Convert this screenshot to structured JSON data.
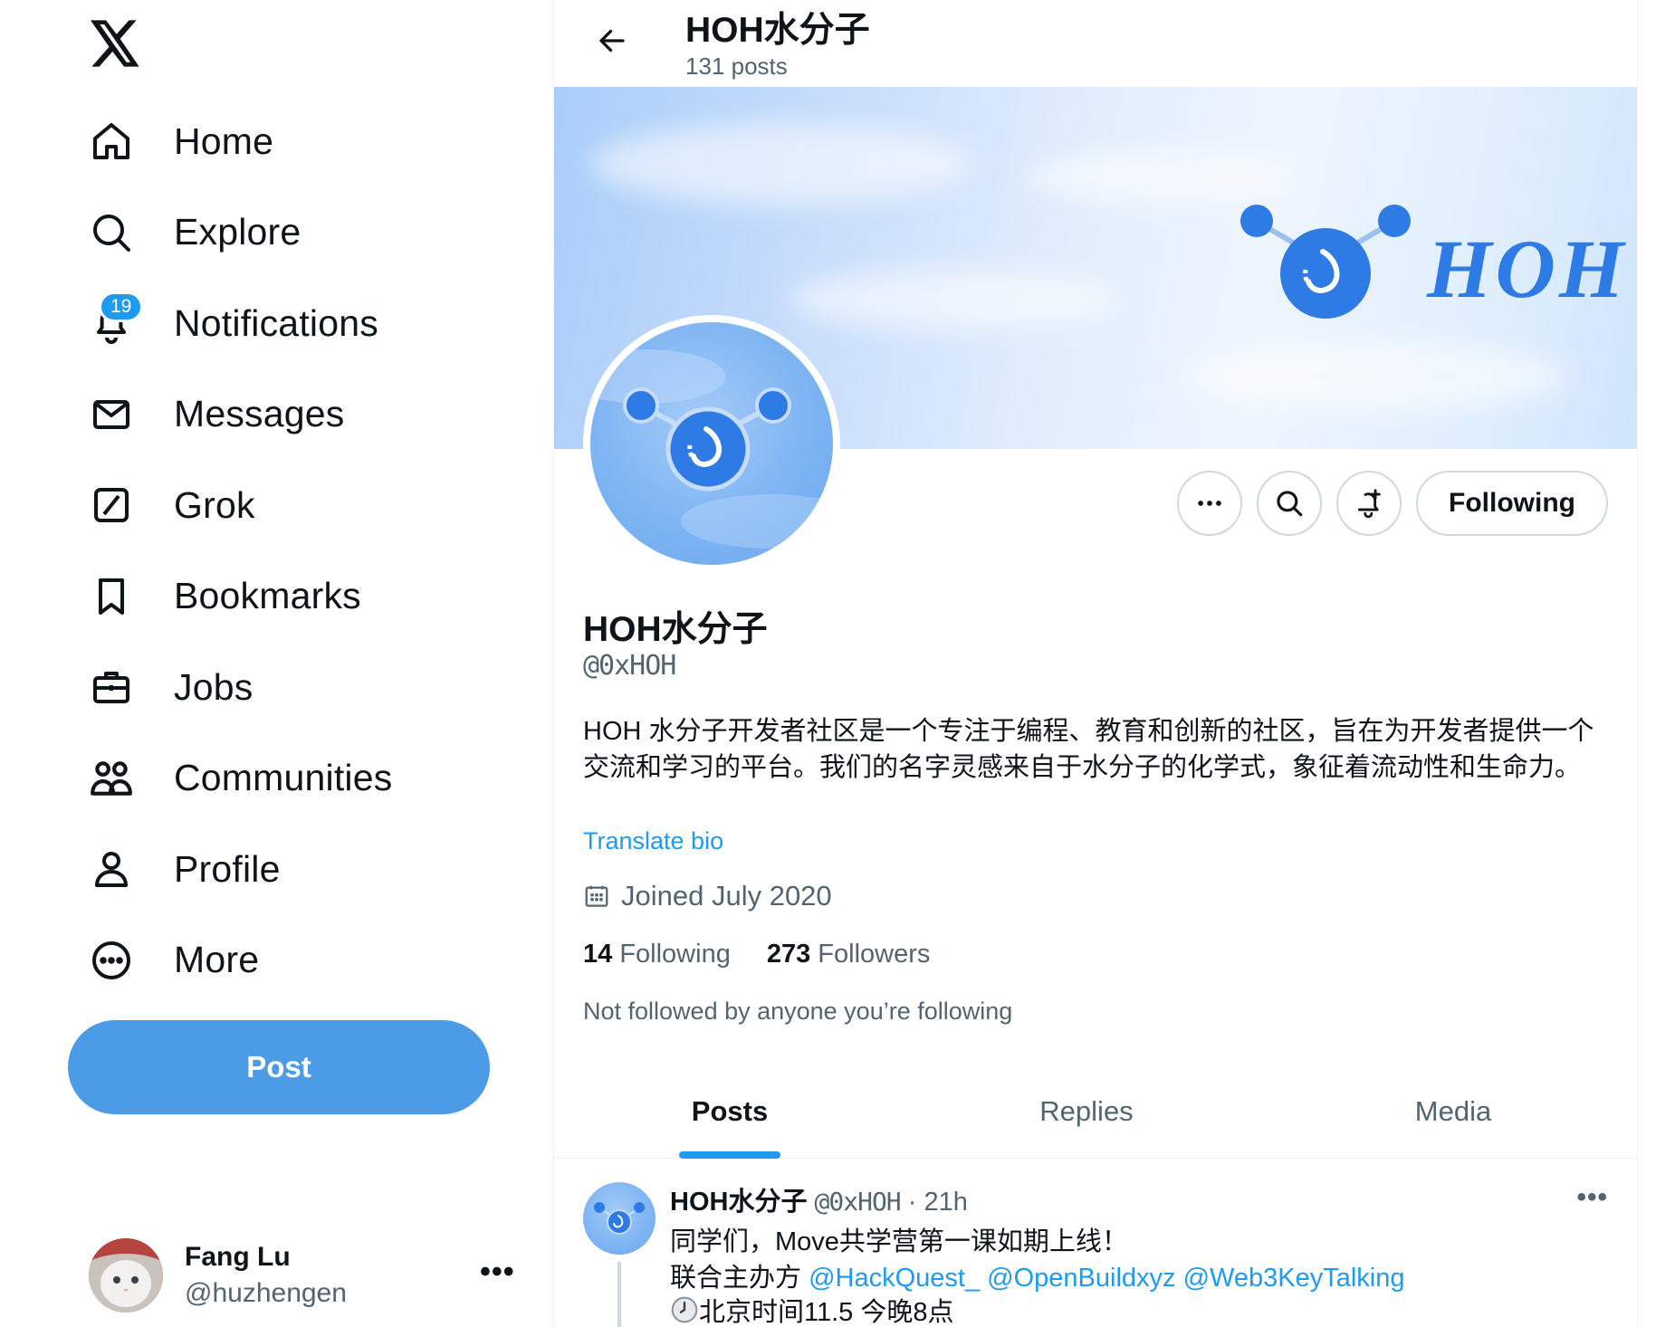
{
  "sidebar": {
    "logo_icon": "x-logo-icon",
    "items": [
      {
        "label": "Home",
        "icon": "home-icon"
      },
      {
        "label": "Explore",
        "icon": "search-icon"
      },
      {
        "label": "Notifications",
        "icon": "bell-icon",
        "badge": "19"
      },
      {
        "label": "Messages",
        "icon": "envelope-icon"
      },
      {
        "label": "Grok",
        "icon": "grok-icon"
      },
      {
        "label": "Bookmarks",
        "icon": "bookmark-icon"
      },
      {
        "label": "Jobs",
        "icon": "briefcase-icon"
      },
      {
        "label": "Communities",
        "icon": "people-icon"
      },
      {
        "label": "Profile",
        "icon": "person-icon"
      },
      {
        "label": "More",
        "icon": "more-circle-icon"
      }
    ],
    "post_label": "Post",
    "account": {
      "name": "Fang Lu",
      "handle": "@huzhengen"
    }
  },
  "profile": {
    "header_title": "HOH水分子",
    "post_count": "131 posts",
    "banner_text": "HOH",
    "name": "HOH水分子",
    "handle": "@0xHOH",
    "bio": "HOH 水分子开发者社区是一个专注于编程、教育和创新的社区，旨在为开发者提供一个交流和学习的平台。我们的名字灵感来自于水分子的化学式，象征着流动性和生命力。",
    "translate_label": "Translate bio",
    "joined": "Joined July 2020",
    "following_count": "14",
    "following_label": "Following",
    "followers_count": "273",
    "followers_label": "Followers",
    "not_followed": "Not followed by anyone you’re following",
    "following_button": "Following"
  },
  "tabs": [
    {
      "label": "Posts",
      "active": true
    },
    {
      "label": "Replies",
      "active": false
    },
    {
      "label": "Media",
      "active": false
    }
  ],
  "tweet": {
    "name": "HOH水分子",
    "handle": "@0xHOH",
    "separator": "·",
    "time": "21h",
    "line1": "同学们，Move共学营第一课如期上线！",
    "line2_prefix": "联合主办方",
    "mentions": [
      "@HackQuest_",
      "@OpenBuildxyz",
      "@Web3KeyTalking"
    ],
    "line3": "北京时间11.5 今晚8点"
  },
  "colors": {
    "accent": "#1d9bf0",
    "post_button": "#4c9be6",
    "brand_blue": "#2f7be6"
  }
}
